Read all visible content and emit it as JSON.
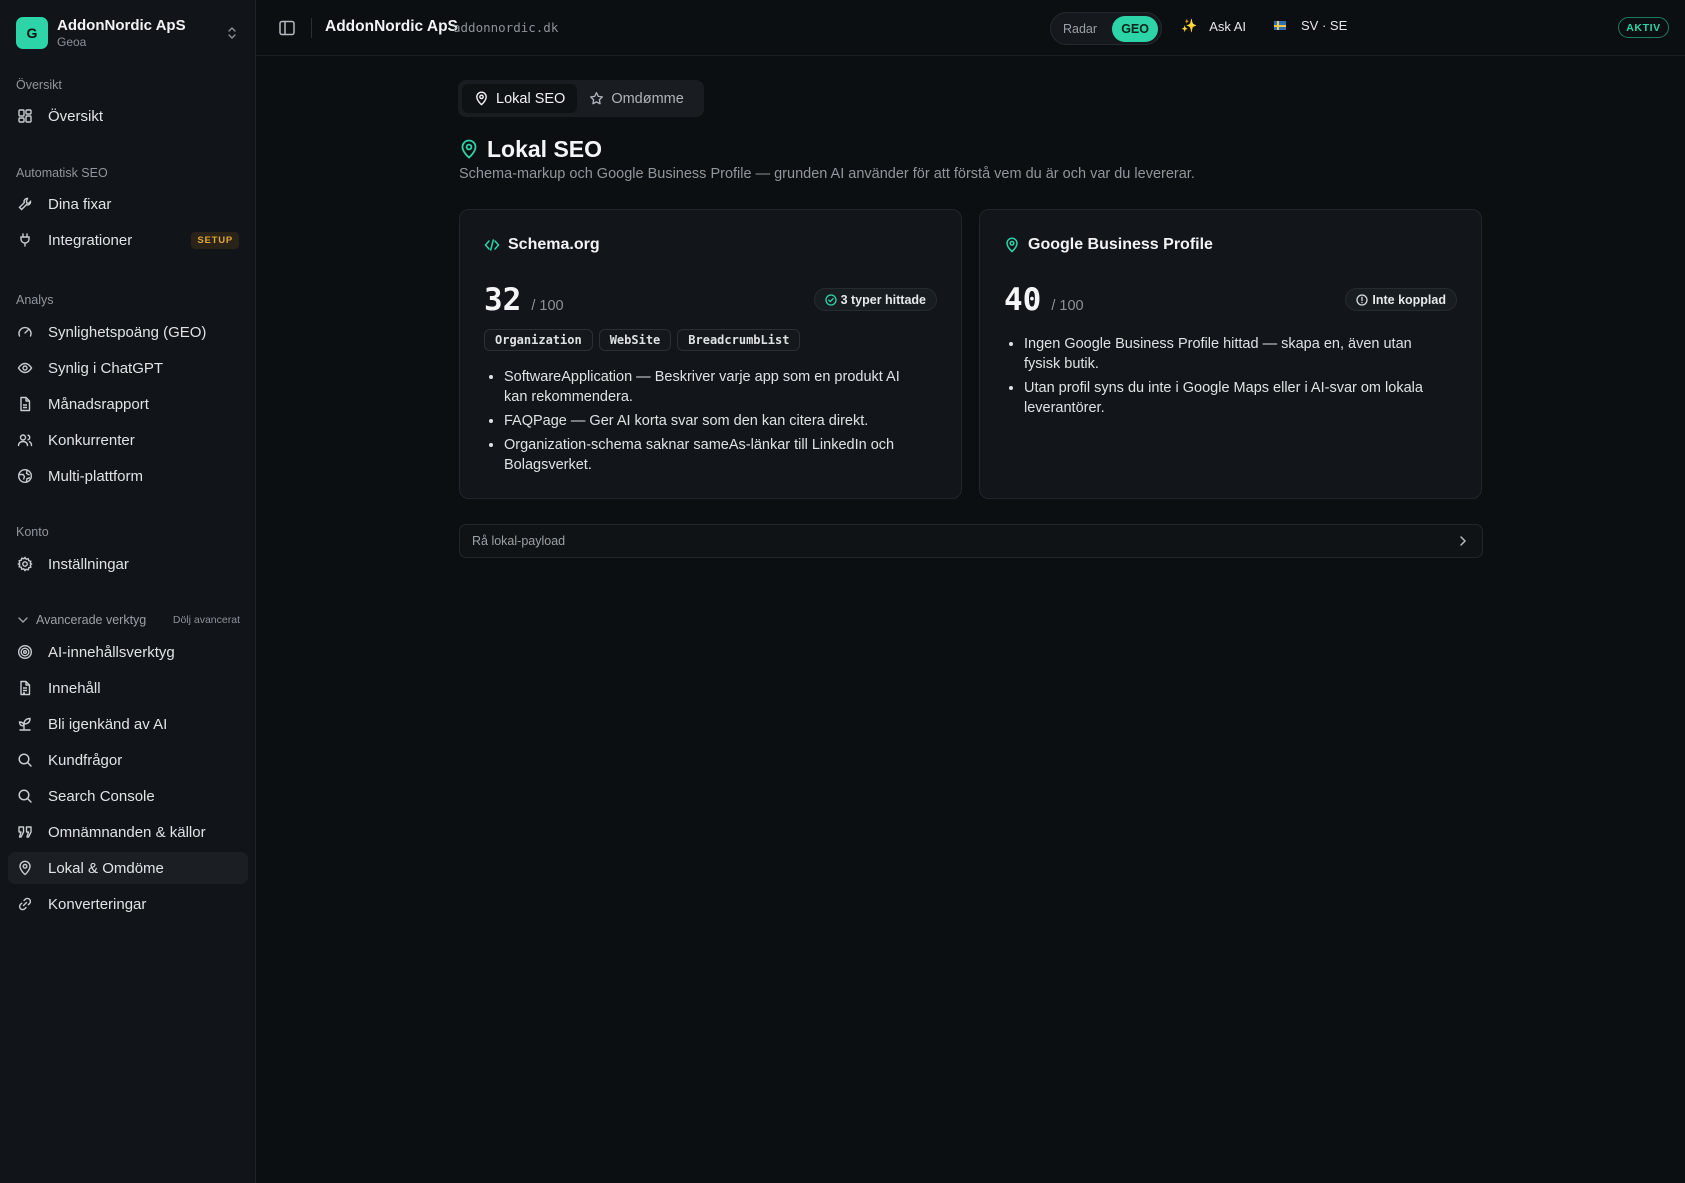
{
  "sidebar": {
    "org": {
      "logo_letter": "G",
      "name": "AddonNordic ApS",
      "subtitle": "Geoa"
    },
    "sections": {
      "overview": "Översikt",
      "auto_seo": "Automatisk SEO",
      "analysis": "Analys",
      "account": "Konto"
    },
    "items": {
      "overview": "Översikt",
      "fixes": "Dina fixar",
      "integrations": "Integrationer",
      "integrations_badge": "SETUP",
      "visibility_score": "Synlighetspoäng (GEO)",
      "chatgpt": "Synlig i ChatGPT",
      "monthly_report": "Månadsrapport",
      "competitors": "Konkurrenter",
      "multi_platform": "Multi-plattform",
      "settings": "Inställningar",
      "ai_content_tool": "AI-innehållsverktyg",
      "content": "Innehåll",
      "recognized_by_ai": "Bli igenkänd av AI",
      "customer_questions": "Kundfrågor",
      "search_console": "Search Console",
      "mentions_sources": "Omnämnanden & källor",
      "local_reputation": "Lokal & Omdöme",
      "conversions": "Konverteringar"
    },
    "advanced": {
      "label": "Avancerade verktyg",
      "hide_label": "Dölj avancerat"
    },
    "active_item": "local_reputation"
  },
  "topbar": {
    "title": "AddonNordic ApS",
    "domain": "addonnordic.dk",
    "mode_options": [
      "Radar",
      "GEO"
    ],
    "mode_selected": "GEO",
    "ask_ai": "Ask AI",
    "language": "SV · SE",
    "status": "AKTIV"
  },
  "main": {
    "tabs": [
      {
        "label": "Lokal SEO",
        "icon": "map-pin-icon",
        "active": true
      },
      {
        "label": "Omdømme",
        "icon": "star-icon",
        "active": false
      }
    ],
    "title": "Lokal SEO",
    "description": "Schema-markup och Google Business Profile — grunden AI använder för att förstå vem du är och var du levererar.",
    "schema_card": {
      "title": "Schema.org",
      "score": "32",
      "score_max": "/ 100",
      "status": "3 typer hittade",
      "types": [
        "Organization",
        "WebSite",
        "BreadcrumbList"
      ],
      "bullets": [
        "SoftwareApplication — Beskriver varje app som en produkt AI kan rekommendera.",
        "FAQPage — Ger AI korta svar som den kan citera direkt.",
        "Organization-schema saknar sameAs-länkar till LinkedIn och Bolagsverket."
      ]
    },
    "gbp_card": {
      "title": "Google Business Profile",
      "score": "40",
      "score_max": "/ 100",
      "status": "Inte kopplad",
      "bullets": [
        "Ingen Google Business Profile hittad — skapa en, även utan fysisk butik.",
        "Utan profil syns du inte i Google Maps eller i AI-svar om lokala leverantörer."
      ]
    },
    "payload_label": "Rå lokal-payload"
  },
  "colors": {
    "accent": "#2dd4a7",
    "background": "#0c0f12",
    "sidebar": "#111418",
    "card": "#12161a",
    "setup_badge": "#e0a63a"
  }
}
